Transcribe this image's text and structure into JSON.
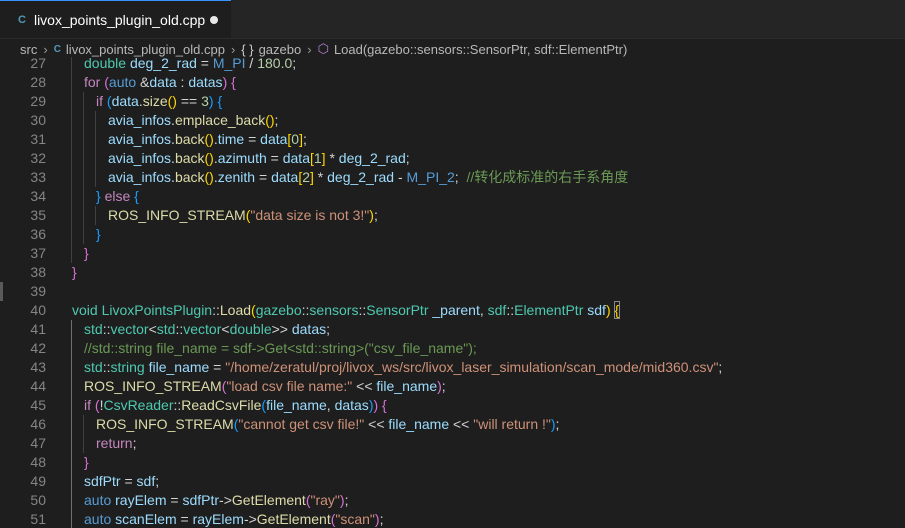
{
  "tab": {
    "icon": "cpp-file-icon",
    "icon_glyph": "C",
    "filename": "livox_points_plugin_old.cpp"
  },
  "breadcrumb": {
    "folder": "src",
    "file": "livox_points_plugin_old.cpp",
    "namespace_glyph": "{ }",
    "namespace": "gazebo",
    "method_glyph": "⬡",
    "method": "Load(gazebo::sensors::SensorPtr, sdf::ElementPtr)"
  },
  "lines": [
    {
      "n": "27",
      "t": [
        [
          "ty",
          "double"
        ],
        [
          "pl",
          " "
        ],
        [
          "var",
          "deg_2_rad"
        ],
        [
          "pl",
          " = "
        ],
        [
          "mac",
          "M_PI"
        ],
        [
          "pl",
          " / "
        ],
        [
          "num",
          "180.0"
        ],
        [
          "pl",
          ";"
        ]
      ]
    },
    {
      "n": "28",
      "t": [
        [
          "ctl",
          "for"
        ],
        [
          "pl",
          " "
        ],
        [
          "br2",
          "("
        ],
        [
          "kw",
          "auto"
        ],
        [
          "pl",
          " &"
        ],
        [
          "var",
          "data"
        ],
        [
          "pl",
          " : "
        ],
        [
          "var",
          "datas"
        ],
        [
          "br2",
          ")"
        ],
        [
          "pl",
          " "
        ],
        [
          "br2",
          "{"
        ]
      ]
    },
    {
      "n": "29",
      "t": [
        [
          "ctl",
          "if"
        ],
        [
          "pl",
          " "
        ],
        [
          "br3",
          "("
        ],
        [
          "var",
          "data"
        ],
        [
          "pl",
          "."
        ],
        [
          "fn",
          "size"
        ],
        [
          "br1",
          "()"
        ],
        [
          "pl",
          " == "
        ],
        [
          "num",
          "3"
        ],
        [
          "br3",
          ")"
        ],
        [
          "pl",
          " "
        ],
        [
          "br3",
          "{"
        ]
      ]
    },
    {
      "n": "30",
      "t": [
        [
          "var",
          "avia_infos"
        ],
        [
          "pl",
          "."
        ],
        [
          "fn",
          "emplace_back"
        ],
        [
          "br1",
          "()"
        ],
        [
          "pl",
          ";"
        ]
      ]
    },
    {
      "n": "31",
      "t": [
        [
          "var",
          "avia_infos"
        ],
        [
          "pl",
          "."
        ],
        [
          "fn",
          "back"
        ],
        [
          "br1",
          "()"
        ],
        [
          "pl",
          "."
        ],
        [
          "var",
          "time"
        ],
        [
          "pl",
          " = "
        ],
        [
          "var",
          "data"
        ],
        [
          "br1",
          "["
        ],
        [
          "num",
          "0"
        ],
        [
          "br1",
          "]"
        ],
        [
          "pl",
          ";"
        ]
      ]
    },
    {
      "n": "32",
      "t": [
        [
          "var",
          "avia_infos"
        ],
        [
          "pl",
          "."
        ],
        [
          "fn",
          "back"
        ],
        [
          "br1",
          "()"
        ],
        [
          "pl",
          "."
        ],
        [
          "var",
          "azimuth"
        ],
        [
          "pl",
          " = "
        ],
        [
          "var",
          "data"
        ],
        [
          "br1",
          "["
        ],
        [
          "num",
          "1"
        ],
        [
          "br1",
          "]"
        ],
        [
          "pl",
          " * "
        ],
        [
          "var",
          "deg_2_rad"
        ],
        [
          "pl",
          ";"
        ]
      ]
    },
    {
      "n": "33",
      "t": [
        [
          "var",
          "avia_infos"
        ],
        [
          "pl",
          "."
        ],
        [
          "fn",
          "back"
        ],
        [
          "br1",
          "()"
        ],
        [
          "pl",
          "."
        ],
        [
          "var",
          "zenith"
        ],
        [
          "pl",
          " = "
        ],
        [
          "var",
          "data"
        ],
        [
          "br1",
          "["
        ],
        [
          "num",
          "2"
        ],
        [
          "br1",
          "]"
        ],
        [
          "pl",
          " * "
        ],
        [
          "var",
          "deg_2_rad"
        ],
        [
          "pl",
          " - "
        ],
        [
          "mac",
          "M_PI_2"
        ],
        [
          "pl",
          ";  "
        ],
        [
          "cm",
          "//转化成标准的右手系角度"
        ]
      ]
    },
    {
      "n": "34",
      "t": [
        [
          "br3",
          "}"
        ],
        [
          "pl",
          " "
        ],
        [
          "ctl",
          "else"
        ],
        [
          "pl",
          " "
        ],
        [
          "br3",
          "{"
        ]
      ]
    },
    {
      "n": "35",
      "t": [
        [
          "fn",
          "ROS_INFO_STREAM"
        ],
        [
          "br1",
          "("
        ],
        [
          "str",
          "\"data size is not 3!\""
        ],
        [
          "br1",
          ")"
        ],
        [
          "pl",
          ";"
        ]
      ]
    },
    {
      "n": "36",
      "t": [
        [
          "br3",
          "}"
        ]
      ]
    },
    {
      "n": "37",
      "t": [
        [
          "br2",
          "}"
        ]
      ]
    },
    {
      "n": "38",
      "t": [
        [
          "br2",
          "}"
        ]
      ]
    },
    {
      "n": "39",
      "t": []
    },
    {
      "n": "40",
      "t": [
        [
          "ty",
          "void"
        ],
        [
          "pl",
          " "
        ],
        [
          "ty",
          "LivoxPointsPlugin"
        ],
        [
          "pl",
          "::"
        ],
        [
          "fn",
          "Load"
        ],
        [
          "br1",
          "("
        ],
        [
          "ty",
          "gazebo"
        ],
        [
          "pl",
          "::"
        ],
        [
          "ty",
          "sensors"
        ],
        [
          "pl",
          "::"
        ],
        [
          "ty",
          "SensorPtr"
        ],
        [
          "pl",
          " "
        ],
        [
          "var",
          "_parent"
        ],
        [
          "pl",
          ", "
        ],
        [
          "ty",
          "sdf"
        ],
        [
          "pl",
          "::"
        ],
        [
          "ty",
          "ElementPtr"
        ],
        [
          "pl",
          " "
        ],
        [
          "var",
          "sdf"
        ],
        [
          "br1",
          ")"
        ],
        [
          "pl",
          " "
        ],
        [
          "br1",
          "{"
        ]
      ]
    },
    {
      "n": "41",
      "t": [
        [
          "ty",
          "std"
        ],
        [
          "pl",
          "::"
        ],
        [
          "ty",
          "vector"
        ],
        [
          "pl",
          "<"
        ],
        [
          "ty",
          "std"
        ],
        [
          "pl",
          "::"
        ],
        [
          "ty",
          "vector"
        ],
        [
          "pl",
          "<"
        ],
        [
          "ty",
          "double"
        ],
        [
          "pl",
          ">> "
        ],
        [
          "var",
          "datas"
        ],
        [
          "pl",
          ";"
        ]
      ]
    },
    {
      "n": "42",
      "t": [
        [
          "cm",
          "//std::string file_name = sdf->Get<std::string>(\"csv_file_name\");"
        ]
      ]
    },
    {
      "n": "43",
      "t": [
        [
          "ty",
          "std"
        ],
        [
          "pl",
          "::"
        ],
        [
          "ty",
          "string"
        ],
        [
          "pl",
          " "
        ],
        [
          "var",
          "file_name"
        ],
        [
          "pl",
          " = "
        ],
        [
          "str",
          "\"/home/zeratul/proj/livox_ws/src/livox_laser_simulation/scan_mode/mid360.csv\""
        ],
        [
          "pl",
          ";"
        ]
      ]
    },
    {
      "n": "44",
      "t": [
        [
          "fn",
          "ROS_INFO_STREAM"
        ],
        [
          "br2",
          "("
        ],
        [
          "str",
          "\"load csv file name:\""
        ],
        [
          "pl",
          " << "
        ],
        [
          "var",
          "file_name"
        ],
        [
          "br2",
          ")"
        ],
        [
          "pl",
          ";"
        ]
      ]
    },
    {
      "n": "45",
      "t": [
        [
          "ctl",
          "if"
        ],
        [
          "pl",
          " "
        ],
        [
          "br2",
          "("
        ],
        [
          "pl",
          "!"
        ],
        [
          "ty",
          "CsvReader"
        ],
        [
          "pl",
          "::"
        ],
        [
          "fn",
          "ReadCsvFile"
        ],
        [
          "br3",
          "("
        ],
        [
          "var",
          "file_name"
        ],
        [
          "pl",
          ", "
        ],
        [
          "var",
          "datas"
        ],
        [
          "br3",
          ")"
        ],
        [
          "br2",
          ")"
        ],
        [
          "pl",
          " "
        ],
        [
          "br2",
          "{"
        ]
      ]
    },
    {
      "n": "46",
      "t": [
        [
          "fn",
          "ROS_INFO_STREAM"
        ],
        [
          "br3",
          "("
        ],
        [
          "str",
          "\"cannot get csv file!\""
        ],
        [
          "pl",
          " << "
        ],
        [
          "var",
          "file_name"
        ],
        [
          "pl",
          " << "
        ],
        [
          "str",
          "\"will return !\""
        ],
        [
          "br3",
          ")"
        ],
        [
          "pl",
          ";"
        ]
      ]
    },
    {
      "n": "47",
      "t": [
        [
          "ctl",
          "return"
        ],
        [
          "pl",
          ";"
        ]
      ]
    },
    {
      "n": "48",
      "t": [
        [
          "br2",
          "}"
        ]
      ]
    },
    {
      "n": "49",
      "t": [
        [
          "var",
          "sdfPtr"
        ],
        [
          "pl",
          " = "
        ],
        [
          "var",
          "sdf"
        ],
        [
          "pl",
          ";"
        ]
      ]
    },
    {
      "n": "50",
      "t": [
        [
          "kw",
          "auto"
        ],
        [
          "pl",
          " "
        ],
        [
          "var",
          "rayElem"
        ],
        [
          "pl",
          " = "
        ],
        [
          "var",
          "sdfPtr"
        ],
        [
          "pl",
          "->"
        ],
        [
          "fn",
          "GetElement"
        ],
        [
          "br2",
          "("
        ],
        [
          "str",
          "\"ray\""
        ],
        [
          "br2",
          ")"
        ],
        [
          "pl",
          ";"
        ]
      ]
    },
    {
      "n": "51",
      "t": [
        [
          "kw",
          "auto"
        ],
        [
          "pl",
          " "
        ],
        [
          "var",
          "scanElem"
        ],
        [
          "pl",
          " = "
        ],
        [
          "var",
          "rayElem"
        ],
        [
          "pl",
          "->"
        ],
        [
          "fn",
          "GetElement"
        ],
        [
          "br2",
          "("
        ],
        [
          "str",
          "\"scan\""
        ],
        [
          "br2",
          ")"
        ],
        [
          "pl",
          ";"
        ]
      ]
    }
  ]
}
